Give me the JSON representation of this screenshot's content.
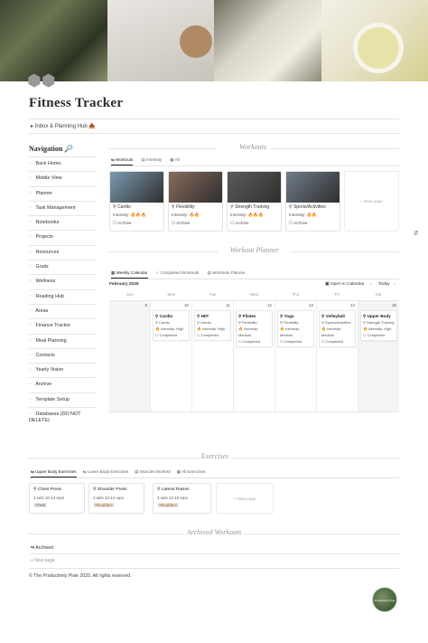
{
  "page": {
    "title": "Fitness Tracker",
    "page_icon": "dumbbell-icon",
    "toggle_text": "Inbox & Planning Hub 📥"
  },
  "navigation": {
    "heading": "Navigation 🔎",
    "items": [
      {
        "icon": "arrow-icon",
        "label": "Back Home."
      },
      {
        "icon": "phone-icon",
        "label": "Mobile View"
      },
      {
        "icon": "calendar-icon",
        "label": "Planner"
      },
      {
        "icon": "check-icon",
        "label": "Task Management"
      },
      {
        "icon": "notebook-icon",
        "label": "Notebooks"
      },
      {
        "icon": "folder-icon",
        "label": "Projects"
      },
      {
        "icon": "box-icon",
        "label": "Resources"
      },
      {
        "icon": "target-icon",
        "label": "Goals"
      },
      {
        "icon": "leaf-icon",
        "label": "Wellness"
      },
      {
        "icon": "book-icon",
        "label": "Reading Hub"
      },
      {
        "icon": "area-icon",
        "label": "Areas"
      },
      {
        "icon": "money-icon",
        "label": "Finance Tracker"
      },
      {
        "icon": "meal-icon",
        "label": "Meal Planning"
      },
      {
        "icon": "contact-icon",
        "label": "Contacts"
      },
      {
        "icon": "vision-icon",
        "label": "Yearly Vision"
      },
      {
        "icon": "archive-icon",
        "label": "Archive"
      },
      {
        "icon": "template-icon",
        "label": "Template Setup"
      },
      {
        "icon": "database-icon",
        "label": "Databases (DO NOT DELETE)"
      }
    ]
  },
  "workouts": {
    "heading": "Workouts",
    "tabs": [
      "Workouts",
      "Intensity",
      "All"
    ],
    "cards": [
      {
        "name": "Cardio",
        "intensity": "Intensity: 🔥🔥🔥",
        "archive": "Archive",
        "color": "#7a9bb0"
      },
      {
        "name": "Flexibility",
        "intensity": "Intensity: 🔥🔥",
        "archive": "Archive",
        "color": "#8a6b5c"
      },
      {
        "name": "Strength Training",
        "intensity": "Intensity: 🔥🔥🔥",
        "archive": "Archive",
        "color": "#5b5b58"
      },
      {
        "name": "Sports/Activities",
        "intensity": "Intensity: 🔥🔥",
        "archive": "Archive",
        "color": "#6f7c88"
      }
    ],
    "new_page": "+ New page"
  },
  "planner": {
    "heading": "Workout Planner",
    "tabs": [
      "Weekly Calendar",
      "Completed Workouts",
      "Workouts Planner"
    ],
    "month": "February 2025",
    "open_calendar": "Open in Calendar",
    "today": "Today",
    "weekdays": [
      "Sun",
      "Mon",
      "Tue",
      "Wed",
      "Thu",
      "Fri",
      "Sat"
    ],
    "days": [
      {
        "num": "9",
        "event": null
      },
      {
        "num": "10",
        "event": {
          "name": "Cardio",
          "type": "Cardio",
          "intensity": "Intensity: High",
          "status": "Completed"
        }
      },
      {
        "num": "11",
        "event": {
          "name": "HIIT",
          "type": "Cardio",
          "intensity": "Intensity: High",
          "status": "Completed"
        }
      },
      {
        "num": "12",
        "event": {
          "name": "Pilates",
          "type": "Flexibility",
          "intensity": "Intensity: Medium",
          "status": "Completed"
        }
      },
      {
        "num": "13",
        "event": {
          "name": "Yoga",
          "type": "Flexibility",
          "intensity": "Intensity: Medium",
          "status": "Completed"
        }
      },
      {
        "num": "14",
        "event": {
          "name": "Volleyball",
          "type": "Sports/Activities",
          "intensity": "Intensity: Medium",
          "status": "Completed"
        }
      },
      {
        "num": "15",
        "event": {
          "name": "Upper Body",
          "type": "Strength Training",
          "intensity": "Intensity: High",
          "status": "Completed"
        }
      }
    ]
  },
  "exercises": {
    "heading": "Exercises",
    "tabs": [
      "Upper Body Exercises",
      "Lower Body Exercises",
      "Muscles Worked",
      "All Exercises"
    ],
    "cards": [
      {
        "name": "Chest Press",
        "sets": "3 sets 10-12 reps",
        "tag": "Chest"
      },
      {
        "name": "Shoulder Press",
        "sets": "3 sets 10-12 reps",
        "tag": "Shoulders"
      },
      {
        "name": "Lateral Raises",
        "sets": "3 sets 12-15 reps",
        "tag": "Shoulders"
      }
    ],
    "new_page": "+ New page"
  },
  "archived": {
    "heading": "Archived Workouts",
    "item": "Archived",
    "new_page": "+ New page"
  },
  "footer": "© The Productivity Pixie 2025. All rights reserved.",
  "badge_text": "Productivity Pixie"
}
